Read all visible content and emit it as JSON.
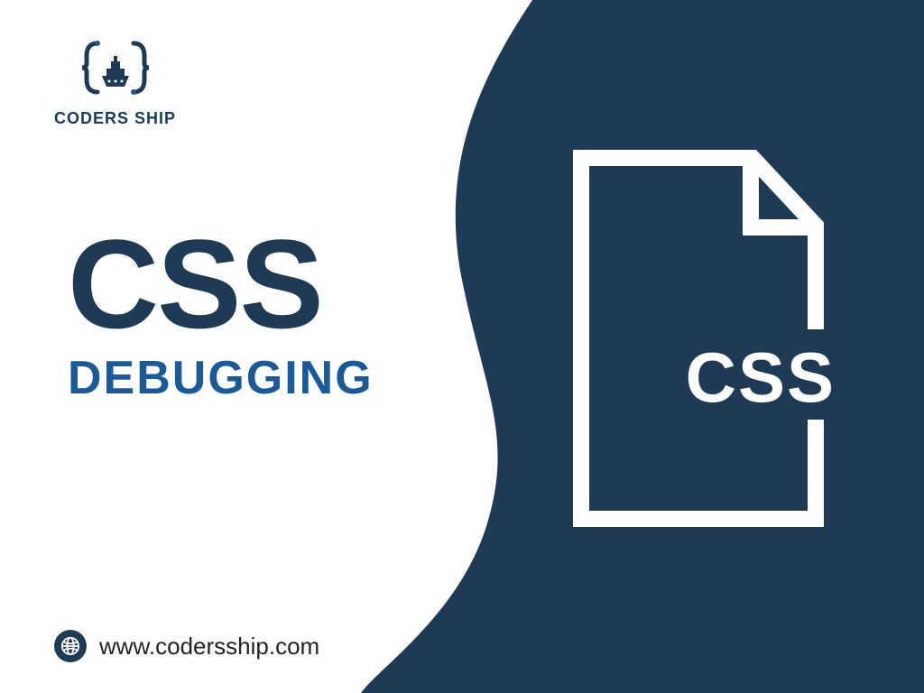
{
  "brand": {
    "name": "CODERS SHIP"
  },
  "headline": {
    "title": "CSS",
    "subtitle": "DEBUGGING"
  },
  "footer": {
    "url": "www.codersship.com"
  },
  "file_icon": {
    "label": "CSS"
  },
  "colors": {
    "dark_navy": "#1e3a55",
    "mid_blue": "#1a5a99",
    "white": "#ffffff"
  }
}
